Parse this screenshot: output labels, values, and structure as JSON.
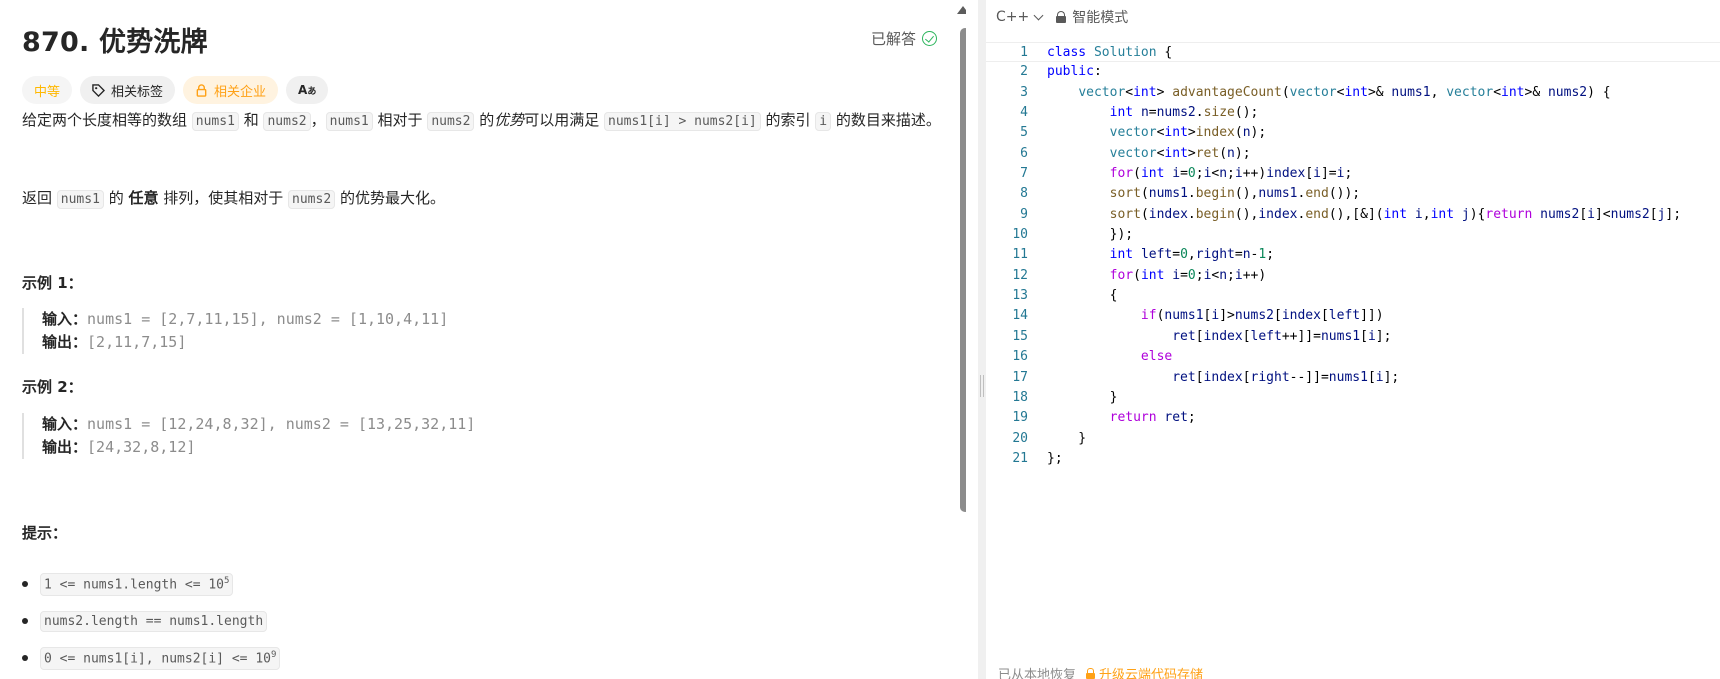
{
  "problem": {
    "title": "870. 优势洗牌",
    "status": "已解答",
    "tags": {
      "difficulty": "中等",
      "topics": "相关标签",
      "companies": "相关企业",
      "translate": "Aあ"
    },
    "description": {
      "p1_a": "给定两个长度相等的数组 ",
      "p1_code1": "nums1",
      "p1_b": " 和 ",
      "p1_code2": "nums2",
      "p1_c": "，",
      "p1_code3": "nums1",
      "p1_d": " 相对于 ",
      "p1_code4": "nums2",
      "p1_e": " 的",
      "p1_em": "优势",
      "p1_f": "可以用满足 ",
      "p1_code5": "nums1[i] > nums2[i]",
      "p1_g": " 的索引 ",
      "p1_code6": "i",
      "p1_h": " 的数目来描述。",
      "p2_a": "返回 ",
      "p2_code1": "nums1",
      "p2_b": " 的 ",
      "p2_bold": "任意",
      "p2_c": " 排列，使其相对于 ",
      "p2_code2": "nums2",
      "p2_d": " 的优势最大化。"
    },
    "examples": [
      {
        "heading": "示例 1：",
        "input_label": "输入：",
        "input": "nums1 = [2,7,11,15], nums2 = [1,10,4,11]",
        "output_label": "输出：",
        "output": "[2,11,7,15]"
      },
      {
        "heading": "示例 2：",
        "input_label": "输入：",
        "input": "nums1 = [12,24,8,32], nums2 = [13,25,32,11]",
        "output_label": "输出：",
        "output": "[24,32,8,12]"
      }
    ],
    "hints_heading": "提示：",
    "constraints": [
      {
        "base": "1 <= nums1.length <= 10",
        "sup": "5"
      },
      {
        "base": "nums2.length == nums1.length",
        "sup": ""
      },
      {
        "base": "0 <= nums1[i], nums2[i] <= 10",
        "sup": "9"
      }
    ]
  },
  "editor": {
    "language": "C++",
    "mode": "智能模式",
    "line_numbers": [
      "1",
      "2",
      "3",
      "4",
      "5",
      "6",
      "7",
      "8",
      "9",
      "10",
      "11",
      "12",
      "13",
      "14",
      "15",
      "16",
      "17",
      "18",
      "19",
      "20",
      "21"
    ],
    "footer_restore": "已从本地恢复",
    "footer_upgrade": "升级云端代码存储"
  }
}
